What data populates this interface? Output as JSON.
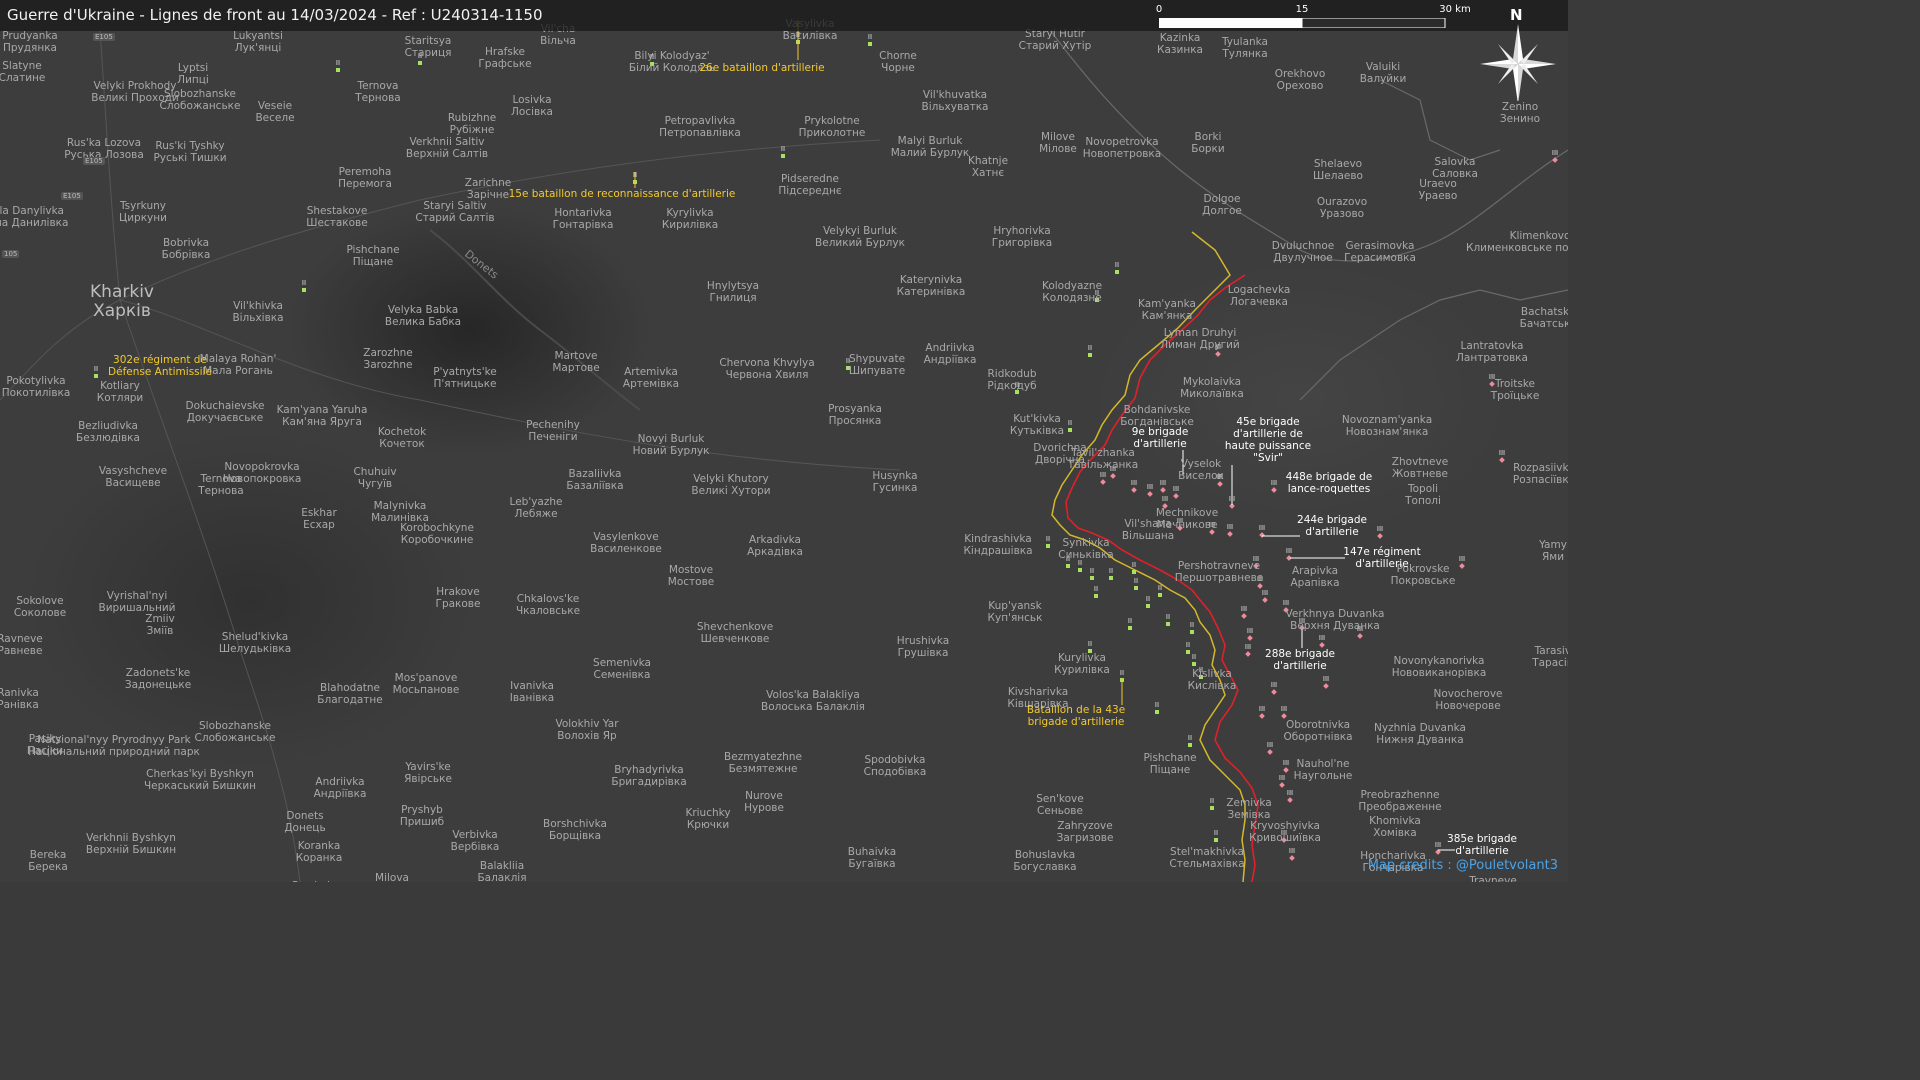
{
  "title": "Guerre d'Ukraine - Lignes de front au 14/03/2024 - Ref : U240314-1150",
  "scale_bar": {
    "labels": [
      "0",
      "15",
      "30 km"
    ]
  },
  "north_arrow": {
    "label": "N",
    "icon": "compass-star-icon"
  },
  "credits": "Map credits : @Pouletvolant3",
  "colors": {
    "front_line_russian": "#e0202a",
    "front_line_ukrainian": "#d4b82a",
    "russian_unit": "#f08a9c",
    "ukrainian_unit": "#a8e060",
    "unit_label_ukraine": "#f3c92b"
  },
  "roads": [
    "E105",
    "E105",
    "E105",
    "105"
  ],
  "river": "Donets",
  "places": [
    {
      "lat": "Prudyanka",
      "ua": "Прудянка"
    },
    {
      "lat": "Lukyantsi",
      "ua": "Лук'янці"
    },
    {
      "lat": "Staritsya",
      "ua": "Стариця"
    },
    {
      "lat": "Vil'cha",
      "ua": "Вільча"
    },
    {
      "lat": "Vasylivka",
      "ua": "Василівка"
    },
    {
      "lat": "Staryi Hutir",
      "ua": "Старий Хутір"
    },
    {
      "lat": "Kazinka",
      "ua": "Казинка"
    },
    {
      "lat": "Tyulanka",
      "ua": "Тулянка"
    },
    {
      "lat": "Slatyne",
      "ua": "Слатине"
    },
    {
      "lat": "Lyptsi",
      "ua": "Липці"
    },
    {
      "lat": "Velyki Prokhody",
      "ua": "Великі Проходи"
    },
    {
      "lat": "Slobozhanske",
      "ua": "Слобожанське"
    },
    {
      "lat": "Ternova",
      "ua": "Тернова"
    },
    {
      "lat": "Hrafske",
      "ua": "Графське"
    },
    {
      "lat": "Bilyi Kolodyaz'",
      "ua": "Білий Колодязь"
    },
    {
      "lat": "Chorne",
      "ua": "Чорне"
    },
    {
      "lat": "Orekhovo",
      "ua": "Орехово"
    },
    {
      "lat": "Valuiki",
      "ua": "Валуйки"
    },
    {
      "lat": "Veseie",
      "ua": "Веселе"
    },
    {
      "lat": "Losivka",
      "ua": "Лосівка"
    },
    {
      "lat": "Vil'khuvatka",
      "ua": "Вільхуватка"
    },
    {
      "lat": "Zenino",
      "ua": "Зенино"
    },
    {
      "lat": "Rus'ka Lozova",
      "ua": "Руська Лозова"
    },
    {
      "lat": "Rus'ki Tyshky",
      "ua": "Руські Тишки"
    },
    {
      "lat": "Rubizhne",
      "ua": "Рубіжне"
    },
    {
      "lat": "Petropavlivka",
      "ua": "Петропавлівка"
    },
    {
      "lat": "Prykolotne",
      "ua": "Приколотне"
    },
    {
      "lat": "Verkhnii Saltiv",
      "ua": "Верхній Салтів"
    },
    {
      "lat": "Malyi Burluk",
      "ua": "Малий Бурлук"
    },
    {
      "lat": "Milove",
      "ua": "Мілове"
    },
    {
      "lat": "Novopetrovka",
      "ua": "Новопетровка"
    },
    {
      "lat": "Borki",
      "ua": "Борки"
    },
    {
      "lat": "Khatnje",
      "ua": "Хатнє"
    },
    {
      "lat": "Shelaevo",
      "ua": "Шелаево"
    },
    {
      "lat": "Salovka",
      "ua": "Саловка"
    },
    {
      "lat": "Peremoha",
      "ua": "Перемога"
    },
    {
      "lat": "Zarichne",
      "ua": "Зарічне"
    },
    {
      "lat": "Pidseredne",
      "ua": "Підсереднє"
    },
    {
      "lat": "Mala Danylivka",
      "ua": "Мала Данилівка"
    },
    {
      "lat": "Tsyrkuny",
      "ua": "Циркуни"
    },
    {
      "lat": "Shestakove",
      "ua": "Шестакове"
    },
    {
      "lat": "Staryi Saltiv",
      "ua": "Старий Салтів"
    },
    {
      "lat": "Hontarivka",
      "ua": "Гонтарівка"
    },
    {
      "lat": "Kyrylivka",
      "ua": "Кирилівка"
    },
    {
      "lat": "Velykyi Burluk",
      "ua": "Великий Бурлук"
    },
    {
      "lat": "Dolgoe",
      "ua": "Долгое"
    },
    {
      "lat": "Ourazovo",
      "ua": "Уразово"
    },
    {
      "lat": "Uraevo",
      "ua": "Ураево"
    },
    {
      "lat": "Klimenkovo",
      "ua": "Клименковське поселення"
    },
    {
      "lat": "Bobrivka",
      "ua": "Бобрівка"
    },
    {
      "lat": "Pishchane",
      "ua": "Піщане"
    },
    {
      "lat": "Hryhorivka",
      "ua": "Григорівка"
    },
    {
      "lat": "Dvuluchnoe",
      "ua": "Двулучное"
    },
    {
      "lat": "Gerasimovka",
      "ua": "Герасимовка"
    },
    {
      "lat": "Kharkiv",
      "ua": "Харків"
    },
    {
      "lat": "Hnylytsya",
      "ua": "Гнилиця"
    },
    {
      "lat": "Katerynivka",
      "ua": "Катеринівка"
    },
    {
      "lat": "Kolodyazne",
      "ua": "Колодязне"
    },
    {
      "lat": "Logachevka",
      "ua": "Логачевка"
    },
    {
      "lat": "Vil'khivka",
      "ua": "Вільхівка"
    },
    {
      "lat": "Velyka Babka",
      "ua": "Велика Бабка"
    },
    {
      "lat": "Kam'yanka",
      "ua": "Кам'янка"
    },
    {
      "lat": "Bachatsk",
      "ua": "Бачатськ"
    },
    {
      "lat": "Lyman Druhyi",
      "ua": "Лиман Другий"
    },
    {
      "lat": "Lantratovka",
      "ua": "Лантратовка"
    },
    {
      "lat": "Zarozhne",
      "ua": "Заrozhne"
    },
    {
      "lat": "Martove",
      "ua": "Мартове"
    },
    {
      "lat": "Chervona Khvylya",
      "ua": "Червона Хвиля"
    },
    {
      "lat": "Andriivka",
      "ua": "Андріївка"
    },
    {
      "lat": "Malaya Rohan'",
      "ua": "Мала Рогань"
    },
    {
      "lat": "P'yatnyts'ke",
      "ua": "П'ятницьке"
    },
    {
      "lat": "Artemivka",
      "ua": "Артемівка"
    },
    {
      "lat": "Shypuvate",
      "ua": "Шипувате"
    },
    {
      "lat": "Ridkodub",
      "ua": "Рідкодуб"
    },
    {
      "lat": "Mykolaivka",
      "ua": "Миколаївка"
    },
    {
      "lat": "Troitske",
      "ua": "Троїцьке"
    },
    {
      "lat": "Pokotylivka",
      "ua": "Покотилівка"
    },
    {
      "lat": "Kotliary",
      "ua": "Котляри"
    },
    {
      "lat": "Dokuchaievske",
      "ua": "Докучаєвське"
    },
    {
      "lat": "Kam'yana Yaruha",
      "ua": "Кам'яна Яруга"
    },
    {
      "lat": "Kochetok",
      "ua": "Кочеток"
    },
    {
      "lat": "Pechenihy",
      "ua": "Печеніги"
    },
    {
      "lat": "Novyi Burluk",
      "ua": "Новий Бурлук"
    },
    {
      "lat": "Prosyanka",
      "ua": "Просянка"
    },
    {
      "lat": "Bohdanivske",
      "ua": "Богданівське"
    },
    {
      "lat": "Kut'kivka",
      "ua": "Кутьківка"
    },
    {
      "lat": "Novoznam'yanka",
      "ua": "Новознам'янка"
    },
    {
      "lat": "Bezliudivka",
      "ua": "Безлюдівка"
    },
    {
      "lat": "Velyki Khutory",
      "ua": "Великі Хутори"
    },
    {
      "lat": "Husynka",
      "ua": "Гусинка"
    },
    {
      "lat": "Dvorichna",
      "ua": "Дворічна"
    },
    {
      "lat": "Tavil'zhanka",
      "ua": "Тавільжанка"
    },
    {
      "lat": "Zhovtneve",
      "ua": "Жовтневе"
    },
    {
      "lat": "Rozpasiivka",
      "ua": "Розпасіївка"
    },
    {
      "lat": "Vasyshcheve",
      "ua": "Васищеве"
    },
    {
      "lat": "Novopokrovka",
      "ua": "Новопокровка"
    },
    {
      "lat": "Chuhuiv",
      "ua": "Чугуїв"
    },
    {
      "lat": "Bazaliivka",
      "ua": "Базаліївка"
    },
    {
      "lat": "Vyselok",
      "ua": "Виселок"
    },
    {
      "lat": "Topoli",
      "ua": "Тополі"
    },
    {
      "lat": "Ternova",
      "ua": "Тернова"
    },
    {
      "lat": "Malynivka",
      "ua": "Малинівка"
    },
    {
      "lat": "Leb'yazhe",
      "ua": "Лебяже"
    },
    {
      "lat": "Mechnikove",
      "ua": "Мечникове"
    },
    {
      "lat": "Vil'shana",
      "ua": "Вільшана"
    },
    {
      "lat": "Eskhar",
      "ua": "Есхар"
    },
    {
      "lat": "Korobochkyne",
      "ua": "Коробочкине"
    },
    {
      "lat": "Vasylenkove",
      "ua": "Василенкове"
    },
    {
      "lat": "Arkadivka",
      "ua": "Аркадівка"
    },
    {
      "lat": "Kindrashivka",
      "ua": "Кіндрашівка"
    },
    {
      "lat": "Synkivka",
      "ua": "Синьківка"
    },
    {
      "lat": "Yamy",
      "ua": "Ями"
    },
    {
      "lat": "Mostove",
      "ua": "Мостове"
    },
    {
      "lat": "Pershotravneve",
      "ua": "Першотравневе"
    },
    {
      "lat": "Arapivka",
      "ua": "Арапівка"
    },
    {
      "lat": "Pokrovske",
      "ua": "Покровське"
    },
    {
      "lat": "Sokolove",
      "ua": "Соколове"
    },
    {
      "lat": "Vyrishal'nyi",
      "ua": "Виришальний"
    },
    {
      "lat": "Hrakove",
      "ua": "Гракове"
    },
    {
      "lat": "Chkalovs'ke",
      "ua": "Чкаловське"
    },
    {
      "lat": "Kup'yansk",
      "ua": "Куп'янськ"
    },
    {
      "lat": "Verkhnya Duvanka",
      "ua": "Верхня Дуванка"
    },
    {
      "lat": "Zmiiv",
      "ua": "Зміїв"
    },
    {
      "lat": "Shevchenkove",
      "ua": "Шевченкове"
    },
    {
      "lat": "Tarasivka",
      "ua": "Тарасівка"
    },
    {
      "lat": "Ravneve",
      "ua": "Равневе"
    },
    {
      "lat": "Shelud'kivka",
      "ua": "Шелудьківка"
    },
    {
      "lat": "Hrushivka",
      "ua": "Грушівка"
    },
    {
      "lat": "Semenivka",
      "ua": "Семенівка"
    },
    {
      "lat": "Kurylivka",
      "ua": "Курилівка"
    },
    {
      "lat": "Novonykanorivka",
      "ua": "Нововиканорівка"
    },
    {
      "lat": "Zadonets'ke",
      "ua": "Задонецьке"
    },
    {
      "lat": "Blahodatne",
      "ua": "Благодатне"
    },
    {
      "lat": "Mos'panove",
      "ua": "Мосьпанове"
    },
    {
      "lat": "Ivanivka",
      "ua": "Іванівка"
    },
    {
      "lat": "Kivsharivka",
      "ua": "Ківшарівка"
    },
    {
      "lat": "Kislivka",
      "ua": "Кислівка"
    },
    {
      "lat": "Novocherove",
      "ua": "Новочерове"
    },
    {
      "lat": "Ranivka",
      "ua": "Ранівка"
    },
    {
      "lat": "Slobozhanske",
      "ua": "Слобожанське"
    },
    {
      "lat": "Volokhiv Yar",
      "ua": "Волохів Яр"
    },
    {
      "lat": "Volos'ka Balakliya",
      "ua": "Волоська Балаклія"
    },
    {
      "lat": "Oborotnivka",
      "ua": "Оборотнівка"
    },
    {
      "lat": "Nyzhnia Duvanka",
      "ua": "Нижня Дуванка"
    },
    {
      "lat": "Natsional'nyy Pryrodnyy Park",
      "ua": "Національний природний парк"
    },
    {
      "lat": "Pasiky",
      "ua": "Пасіки"
    },
    {
      "lat": "Cherkas'kyi Byshkyn",
      "ua": "Черкаський Бишкин"
    },
    {
      "lat": "Yavirs'ke",
      "ua": "Явірське"
    },
    {
      "lat": "Bryhadyrivka",
      "ua": "Бригадирівка"
    },
    {
      "lat": "Bezmyatezhne",
      "ua": "Безмятежне"
    },
    {
      "lat": "Spodobivka",
      "ua": "Сподобівка"
    },
    {
      "lat": "Pishchane",
      "ua": "Піщане"
    },
    {
      "lat": "Nauhol'ne",
      "ua": "Наугольне"
    },
    {
      "lat": "Andriivka",
      "ua": "Андріївка"
    },
    {
      "lat": "Nurove",
      "ua": "Нурове"
    },
    {
      "lat": "Preobrazhenne",
      "ua": "Преображенне"
    },
    {
      "lat": "Pryshyb",
      "ua": "Пришиб"
    },
    {
      "lat": "Sen'kove",
      "ua": "Сеньове"
    },
    {
      "lat": "Zemivka",
      "ua": "Земівка"
    },
    {
      "lat": "Khomivka",
      "ua": "Хомівка"
    },
    {
      "lat": "Donets",
      "ua": "Донець"
    },
    {
      "lat": "Borshchivka",
      "ua": "Борщівка"
    },
    {
      "lat": "Kriuchky",
      "ua": "Крючки"
    },
    {
      "lat": "Zahryzove",
      "ua": "Загризове"
    },
    {
      "lat": "Kryvoshyivka",
      "ua": "Кривошиївка"
    },
    {
      "lat": "Verkhnii Byshkyn",
      "ua": "Верхній Бишкин"
    },
    {
      "lat": "Koranka",
      "ua": "Коранка"
    },
    {
      "lat": "Verbivka",
      "ua": "Вербівка"
    },
    {
      "lat": "Buhaivka",
      "ua": "Бугаївка"
    },
    {
      "lat": "Bereka",
      "ua": "Берека"
    },
    {
      "lat": "Balakliia",
      "ua": "Балаклія"
    },
    {
      "lat": "Bohuslavka",
      "ua": "Богуславка"
    },
    {
      "lat": "Stel'makhivka",
      "ua": "Стельмахівка"
    },
    {
      "lat": "Honcharivka",
      "ua": "Гончарівка"
    },
    {
      "lat": "Milova",
      "ua": "Милова"
    },
    {
      "lat": "Pryshyb",
      "ua": "Пришиб"
    },
    {
      "lat": "Travneve",
      "ua": "Травневе"
    }
  ],
  "unit_labels_ukraine": [
    "26e bataillon d'artillerie",
    "15e bataillon de reconnaissance d'artillerie",
    "302e régiment de Défense Antimissile",
    "Bataillon de la 43e brigade d'artillerie"
  ],
  "unit_labels_russia": [
    "9e brigade d'artillerie",
    "45e brigade d'artillerie de haute puissance \"Svir\"",
    "448e brigade de lance-roquettes",
    "244e brigade d'artillerie",
    "147e régiment d'artillerie",
    "288e brigade d'artillerie",
    "385e brigade d'artillerie"
  ]
}
